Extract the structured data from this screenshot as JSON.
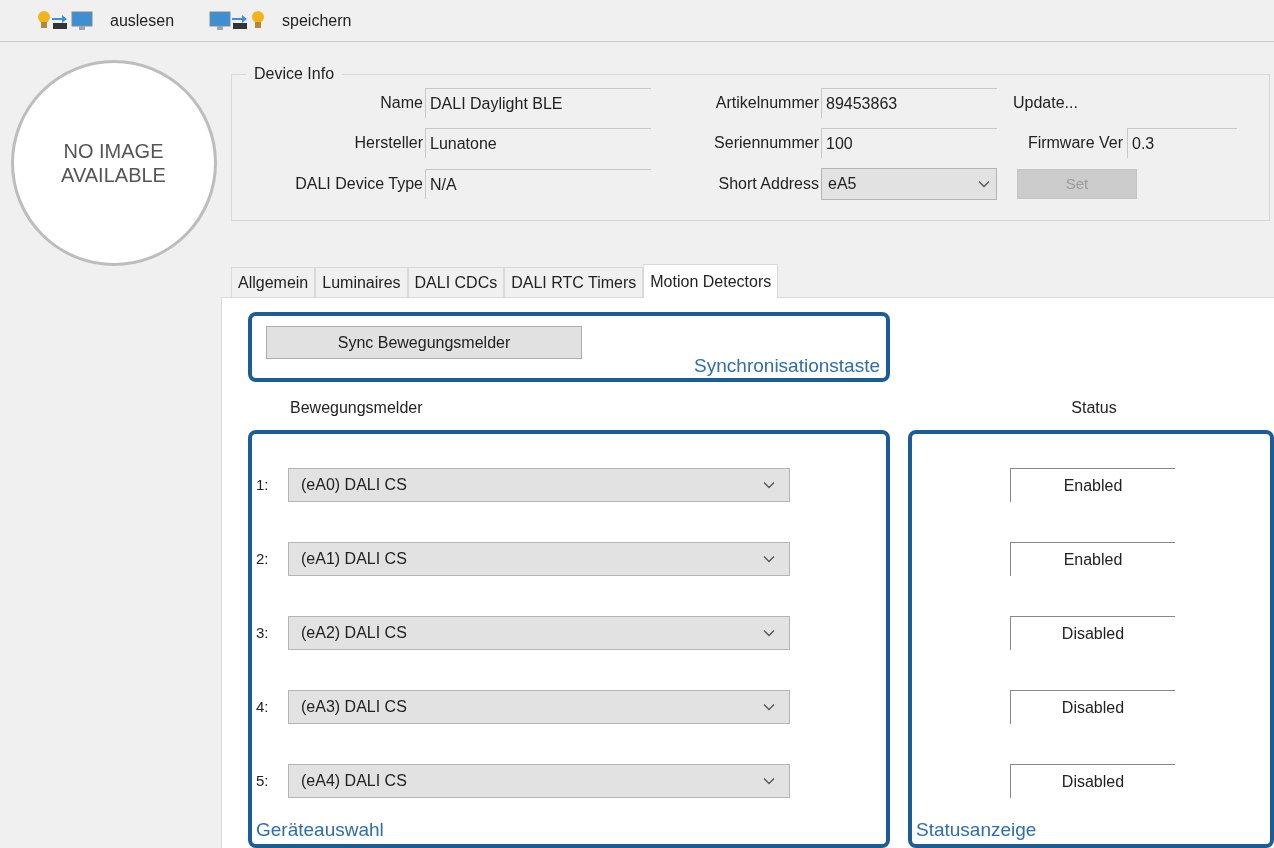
{
  "toolbar": [
    {
      "kind": "read",
      "label": "auslesen"
    },
    {
      "kind": "write",
      "label": "speichern"
    }
  ],
  "image_placeholder": {
    "text": "NO IMAGE AVAILABLE"
  },
  "device_info": {
    "title": "Device Info",
    "fields": [
      {
        "label": "Name",
        "value": "DALI Daylight BLE"
      },
      {
        "label": "Hersteller",
        "value": "Lunatone"
      },
      {
        "label": "DALI Device Type",
        "value": "N/A"
      },
      {
        "label": "Artikelnummer",
        "value": "89453863"
      },
      {
        "label": "Seriennummer",
        "value": "100"
      }
    ],
    "short_address": {
      "label": "Short Address",
      "value": "eA5"
    },
    "update_link": "Update...",
    "firmware": {
      "label": "Firmware Ver",
      "value": "0.3"
    },
    "set_button": {
      "label": "Set",
      "disabled": true
    }
  },
  "tabs": [
    {
      "label": "Allgemein",
      "selected": false
    },
    {
      "label": "Luminaires",
      "selected": false
    },
    {
      "label": "DALI CDCs",
      "selected": false
    },
    {
      "label": "DALI RTC Timers",
      "selected": false
    },
    {
      "label": "Motion Detectors",
      "selected": true
    }
  ],
  "sync_button": "Sync Bewegungsmelder",
  "annotations": [
    "Synchronisationstaste",
    "Geräteauswahl",
    "Statusanzeige"
  ],
  "column_headers": [
    "Bewegungsmelder",
    "Status"
  ],
  "detectors": [
    {
      "number": "1:",
      "device": "(eA0) DALI CS",
      "status": "Enabled"
    },
    {
      "number": "2:",
      "device": "(eA1) DALI CS",
      "status": "Enabled"
    },
    {
      "number": "3:",
      "device": "(eA2) DALI CS",
      "status": "Disabled"
    },
    {
      "number": "4:",
      "device": "(eA3) DALI CS",
      "status": "Disabled"
    },
    {
      "number": "5:",
      "device": "(eA4) DALI CS",
      "status": "Disabled"
    }
  ]
}
